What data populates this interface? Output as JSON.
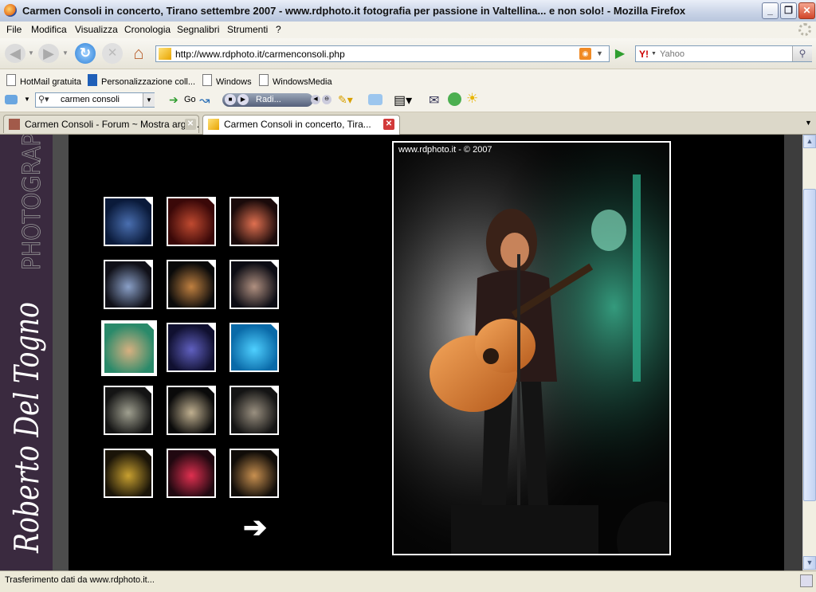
{
  "window": {
    "title": "Carmen Consoli in concerto, Tirano settembre 2007 - www.rdphoto.it fotografia per passione in Valtellina... e non solo! - Mozilla Firefox"
  },
  "menu": [
    "File",
    "Modifica",
    "Visualizza",
    "Cronologia",
    "Segnalibri",
    "Strumenti",
    "?"
  ],
  "navigation": {
    "url": "http://www.rdphoto.it/carmenconsoli.php",
    "search_placeholder": "Yahoo",
    "search_engine_label": "Y!"
  },
  "bookmarks": [
    "HotMail gratuita",
    "Personalizzazione coll...",
    "Windows",
    "WindowsMedia"
  ],
  "toolbar2": {
    "search_value": "carmen consoli",
    "go_label": "Go",
    "radio_label": "Radi..."
  },
  "tabs": [
    {
      "label": "Carmen Consoli - Forum ~ Mostra argo...",
      "active": false
    },
    {
      "label": "Carmen Consoli in concerto, Tira...",
      "active": true
    }
  ],
  "page": {
    "sidebar_text": "Roberto Del Togno",
    "sidebar_heading": "PHOTOGRAP",
    "watermark": "www.rdphoto.it - © 2007",
    "next_arrow": "➔",
    "thumbnails_selected_index": 6,
    "thumbnail_count": 15
  },
  "status": {
    "text": "Trasferimento dati da www.rdphoto.it..."
  },
  "colors": {
    "sidebar_bg": "#3a2a3f",
    "page_bg": "#000000",
    "accent_green": "#3fbf9a"
  }
}
